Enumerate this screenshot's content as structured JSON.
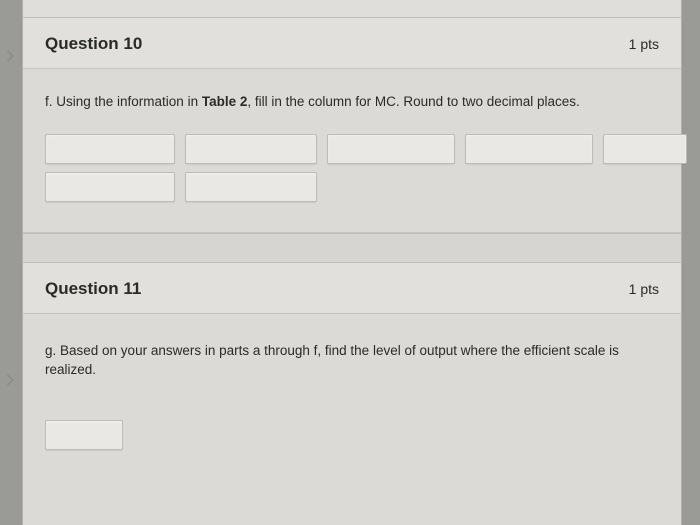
{
  "q10": {
    "title": "Question 10",
    "points": "1 pts",
    "prompt_prefix": "f. Using the information in ",
    "prompt_bold": "Table 2",
    "prompt_suffix": ", fill in the column for MC. Round to two decimal places."
  },
  "q11": {
    "title": "Question 11",
    "points": "1 pts",
    "prompt": "g. Based on your answers in parts a through f, find the level of output where the efficient scale is realized."
  }
}
